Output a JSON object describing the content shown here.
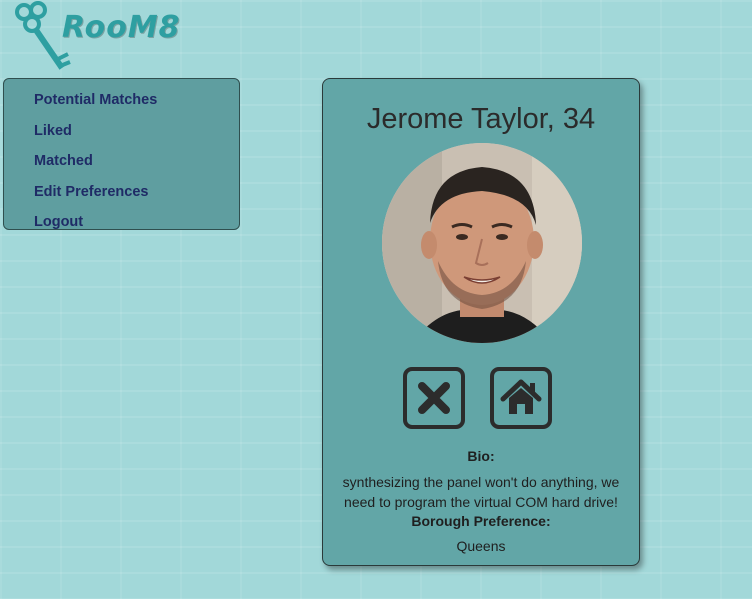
{
  "app": {
    "logo_text": "RooM8"
  },
  "nav": {
    "items": [
      {
        "label": "Potential Matches"
      },
      {
        "label": "Liked"
      },
      {
        "label": "Matched"
      },
      {
        "label": "Edit Preferences"
      },
      {
        "label": "Logout"
      }
    ]
  },
  "profile": {
    "name_age": "Jerome Taylor, 34",
    "bio_label": "Bio:",
    "bio": "synthesizing the panel won't do anything, we need to program the virtual COM hard drive!",
    "borough_label": "Borough Preference:",
    "borough": "Queens"
  },
  "actions": {
    "reject_icon": "close-icon",
    "accept_icon": "home-icon"
  },
  "colors": {
    "background": "#a2d8d9",
    "panel": "#5f9ea0",
    "nav_text": "#1f2b66",
    "logo": "#2e9fa1"
  }
}
